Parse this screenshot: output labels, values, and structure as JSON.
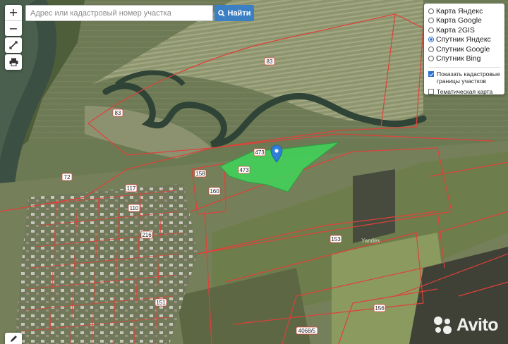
{
  "search": {
    "placeholder": "Адрес или кадастровый номер участка",
    "button_label": "Найти"
  },
  "zoom": {
    "in_label": "+",
    "out_label": "−"
  },
  "layers": {
    "base_maps": [
      {
        "label": "Карта Яндекс",
        "selected": false
      },
      {
        "label": "Карта Google",
        "selected": false
      },
      {
        "label": "Карта 2GIS",
        "selected": false
      },
      {
        "label": "Спутник Яндекс",
        "selected": true
      },
      {
        "label": "Спутник Google",
        "selected": false
      },
      {
        "label": "Спутник Bing",
        "selected": false
      }
    ],
    "overlays": [
      {
        "label": "Показать кадастровые границы участков",
        "checked": true
      },
      {
        "label": "Тематическая карта",
        "checked": false
      }
    ]
  },
  "parcel_labels": [
    "83",
    "83",
    "473",
    "473",
    "72",
    "158",
    "160",
    "117",
    "110",
    "216",
    "151",
    "153",
    "156",
    "4068/5"
  ],
  "map_watermark": "Yandex",
  "avito_logo": "Avito",
  "colors": {
    "boundary": "#e0403a",
    "highlight": "#3fd65a",
    "search_button": "#3b7fc4",
    "radio_selected": "#2a6fd0"
  }
}
